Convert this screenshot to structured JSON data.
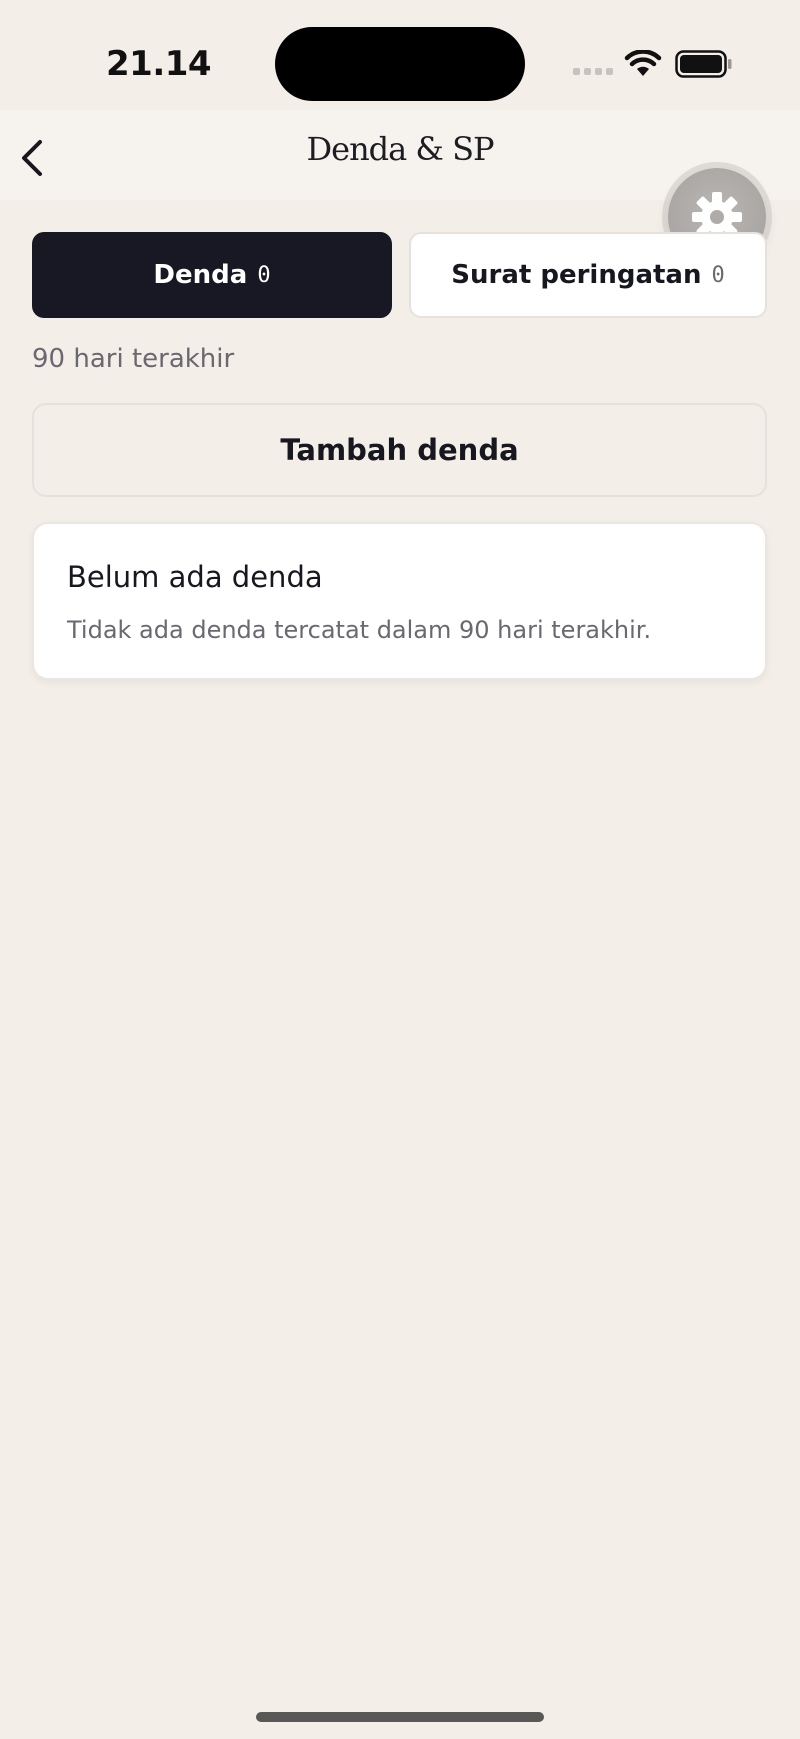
{
  "status_bar": {
    "time": "21.14",
    "icons": [
      "signal-icon",
      "wifi-icon",
      "battery-icon"
    ]
  },
  "nav": {
    "title": "Denda & SP",
    "back_icon": "chevron-left-icon"
  },
  "floating": {
    "icon": "gear-icon"
  },
  "tabs": [
    {
      "label": "Denda",
      "count": "0",
      "active": true
    },
    {
      "label": "Surat peringatan",
      "count": "0",
      "active": false
    }
  ],
  "range_label": "90 hari terakhir",
  "add_button_label": "Tambah denda",
  "empty_state": {
    "title": "Belum ada denda",
    "description": "Tidak ada denda tercatat dalam 90 hari terakhir."
  },
  "colors": {
    "background": "#f4eee8",
    "active_tab": "#181824",
    "card": "#ffffff",
    "muted_text": "#6a6870"
  }
}
